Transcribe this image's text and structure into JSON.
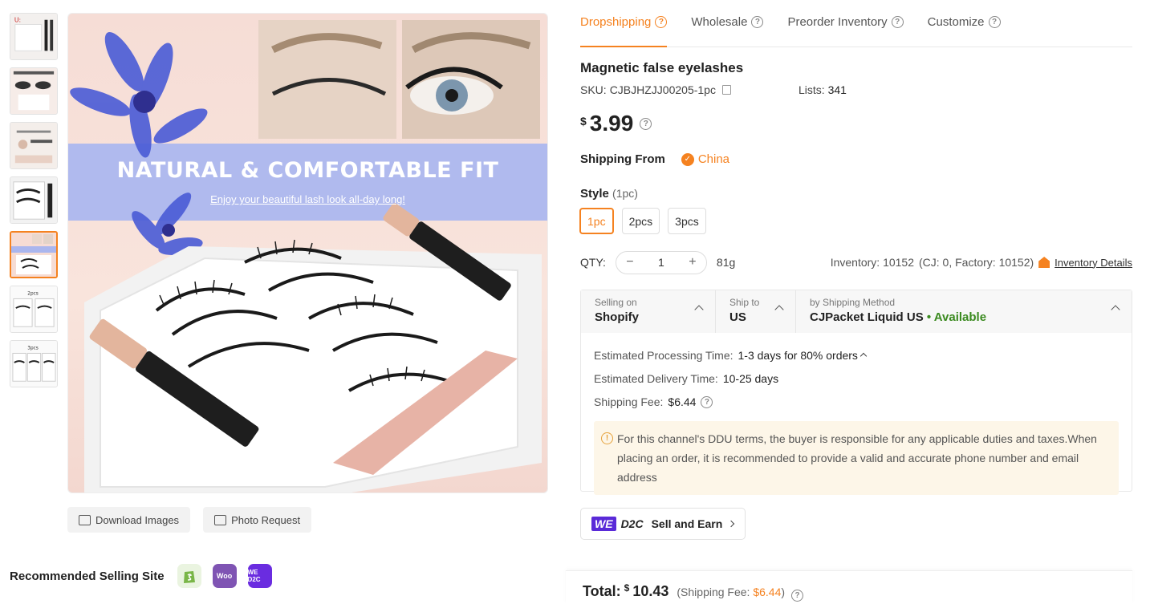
{
  "tabs": [
    {
      "label": "Dropshipping"
    },
    {
      "label": "Wholesale"
    },
    {
      "label": "Preorder Inventory"
    },
    {
      "label": "Customize"
    }
  ],
  "product": {
    "title": "Magnetic false eyelashes",
    "sku_label": "SKU:",
    "sku": "CJBJHZJJ00205-1pc",
    "lists_label": "Lists:",
    "lists": "341",
    "currency": "$",
    "price": "3.99"
  },
  "shipping_from": {
    "label": "Shipping From",
    "value": "China"
  },
  "style": {
    "label": "Style",
    "selected_note": "(1pc)",
    "options": [
      "1pc",
      "2pcs",
      "3pcs"
    ]
  },
  "qty": {
    "label": "QTY:",
    "value": "1",
    "weight": "81g",
    "inventory": "Inventory: 10152",
    "inventory_detail": "(CJ: 0, Factory: 10152)",
    "inventory_link": "Inventory Details"
  },
  "ship_box": {
    "selling_on_label": "Selling on",
    "selling_on": "Shopify",
    "ship_to_label": "Ship to",
    "ship_to": "US",
    "method_label": "by Shipping Method",
    "method": "CJPacket Liquid US",
    "available": "• Available",
    "processing_label": "Estimated Processing Time:",
    "processing": "1-3 days for 80% orders",
    "delivery_label": "Estimated Delivery Time:",
    "delivery": "10-25 days",
    "fee_label": "Shipping Fee:",
    "fee": "$6.44",
    "notice": "For this channel's DDU terms, the buyer is responsible for any applicable duties and taxes.When placing an order, it is recommended to provide a valid and accurate phone number and email address"
  },
  "main_image": {
    "headline": "NATURAL & COMFORTABLE FIT",
    "subline": "Enjoy your beautiful lash look all-day long!"
  },
  "image_buttons": {
    "download": "Download Images",
    "photo_request": "Photo Request"
  },
  "recommended": {
    "label": "Recommended Selling Site",
    "sites": [
      {
        "name": "shopify-icon",
        "text": ""
      },
      {
        "name": "woocommerce-icon",
        "text": "Woo"
      },
      {
        "name": "we-d2c-icon",
        "text": "WE D2C"
      }
    ]
  },
  "d2c": {
    "badge": "WE",
    "brand": "D2C",
    "label": "Sell and Earn"
  },
  "total": {
    "label": "Total:",
    "currency": "$",
    "value": "10.43",
    "fee_prefix": "(Shipping Fee: ",
    "fee": "$6.44",
    "fee_suffix": ")"
  },
  "colors": {
    "accent": "#f58220",
    "available": "#3a8a1f",
    "banner": "#a9b6f0"
  }
}
